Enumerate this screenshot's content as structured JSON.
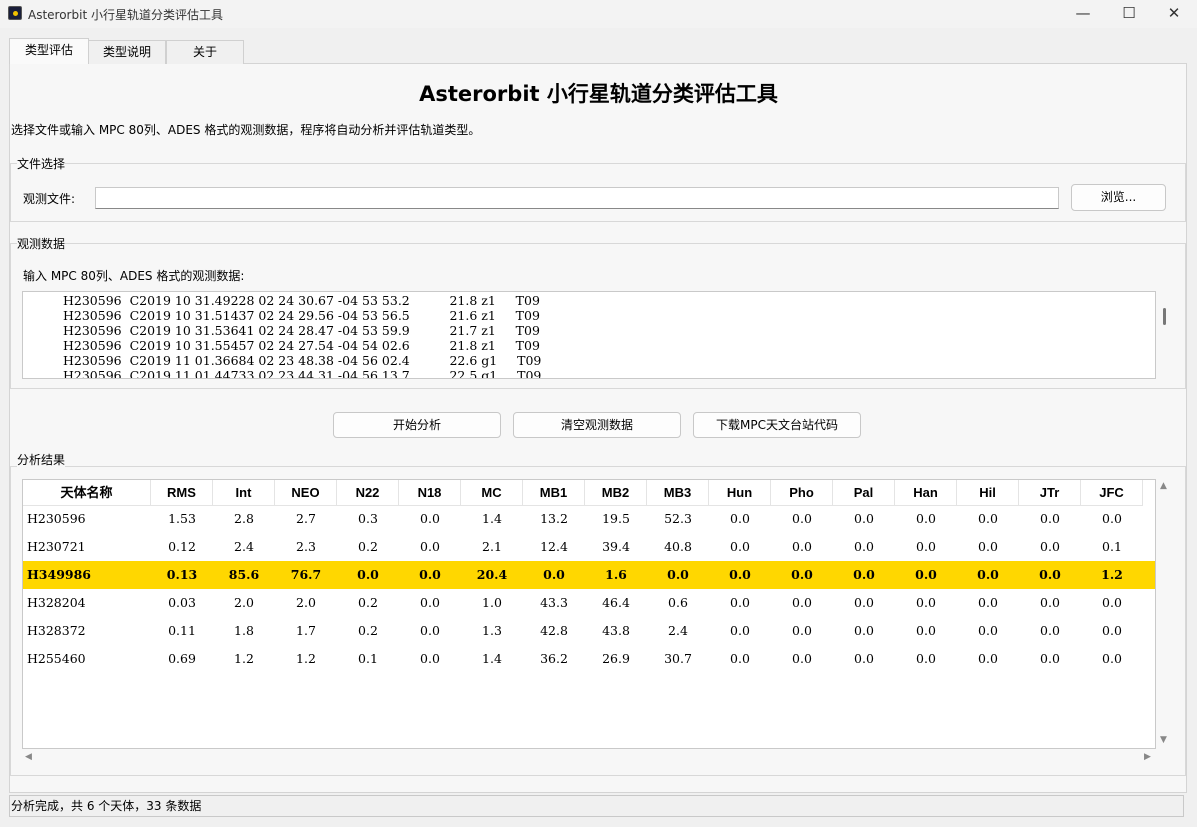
{
  "window": {
    "title": "Asterorbit 小行星轨道分类评估工具"
  },
  "tabs": [
    {
      "label": "类型评估"
    },
    {
      "label": "类型说明"
    },
    {
      "label": "关于"
    }
  ],
  "main": {
    "title": "Asterorbit 小行星轨道分类评估工具",
    "description": "选择文件或输入 MPC 80列、ADES 格式的观测数据，程序将自动分析并评估轨道类型。"
  },
  "file_section": {
    "group_title": "文件选择",
    "label": "观测文件:",
    "value": "",
    "browse_label": "浏览..."
  },
  "obs_section": {
    "group_title": "观测数据",
    "label": "输入 MPC 80列、ADES 格式的观测数据:",
    "lines": [
      "H230596  C2019 10 31.49228 02 24 30.67 -04 53 53.2          21.8 z1     T09",
      "H230596  C2019 10 31.51437 02 24 29.56 -04 53 56.5          21.6 z1     T09",
      "H230596  C2019 10 31.53641 02 24 28.47 -04 53 59.9          21.7 z1     T09",
      "H230596  C2019 10 31.55457 02 24 27.54 -04 54 02.6          21.8 z1     T09",
      "H230596  C2019 11 01.36684 02 23 48.38 -04 56 02.4          22.6 g1     T09",
      "H230596  C2019 11 01.44733 02 23 44.31 -04 56 13.7          22.5 g1     T09"
    ]
  },
  "actions": {
    "start": "开始分析",
    "clear": "清空观测数据",
    "download": "下载MPC天文台站代码"
  },
  "results": {
    "group_title": "分析结果",
    "columns": [
      "天体名称",
      "RMS",
      "Int",
      "NEO",
      "N22",
      "N18",
      "MC",
      "MB1",
      "MB2",
      "MB3",
      "Hun",
      "Pho",
      "Pal",
      "Han",
      "Hil",
      "JTr",
      "JFC"
    ],
    "rows": [
      [
        "H230596",
        "1.53",
        "2.8",
        "2.7",
        "0.3",
        "0.0",
        "1.4",
        "13.2",
        "19.5",
        "52.3",
        "0.0",
        "0.0",
        "0.0",
        "0.0",
        "0.0",
        "0.0",
        "0.0"
      ],
      [
        "H230721",
        "0.12",
        "2.4",
        "2.3",
        "0.2",
        "0.0",
        "2.1",
        "12.4",
        "39.4",
        "40.8",
        "0.0",
        "0.0",
        "0.0",
        "0.0",
        "0.0",
        "0.0",
        "0.1"
      ],
      [
        "H349986",
        "0.13",
        "85.6",
        "76.7",
        "0.0",
        "0.0",
        "20.4",
        "0.0",
        "1.6",
        "0.0",
        "0.0",
        "0.0",
        "0.0",
        "0.0",
        "0.0",
        "0.0",
        "1.2"
      ],
      [
        "H328204",
        "0.03",
        "2.0",
        "2.0",
        "0.2",
        "0.0",
        "1.0",
        "43.3",
        "46.4",
        "0.6",
        "0.0",
        "0.0",
        "0.0",
        "0.0",
        "0.0",
        "0.0",
        "0.0"
      ],
      [
        "H328372",
        "0.11",
        "1.8",
        "1.7",
        "0.2",
        "0.0",
        "1.3",
        "42.8",
        "43.8",
        "2.4",
        "0.0",
        "0.0",
        "0.0",
        "0.0",
        "0.0",
        "0.0",
        "0.0"
      ],
      [
        "H255460",
        "0.69",
        "1.2",
        "1.2",
        "0.1",
        "0.0",
        "1.4",
        "36.2",
        "26.9",
        "30.7",
        "0.0",
        "0.0",
        "0.0",
        "0.0",
        "0.0",
        "0.0",
        "0.0"
      ]
    ],
    "highlight_row": 2,
    "highlight_color": "#ffd700"
  },
  "status": {
    "text": "分析完成，共 6 个天体，33 条数据"
  }
}
